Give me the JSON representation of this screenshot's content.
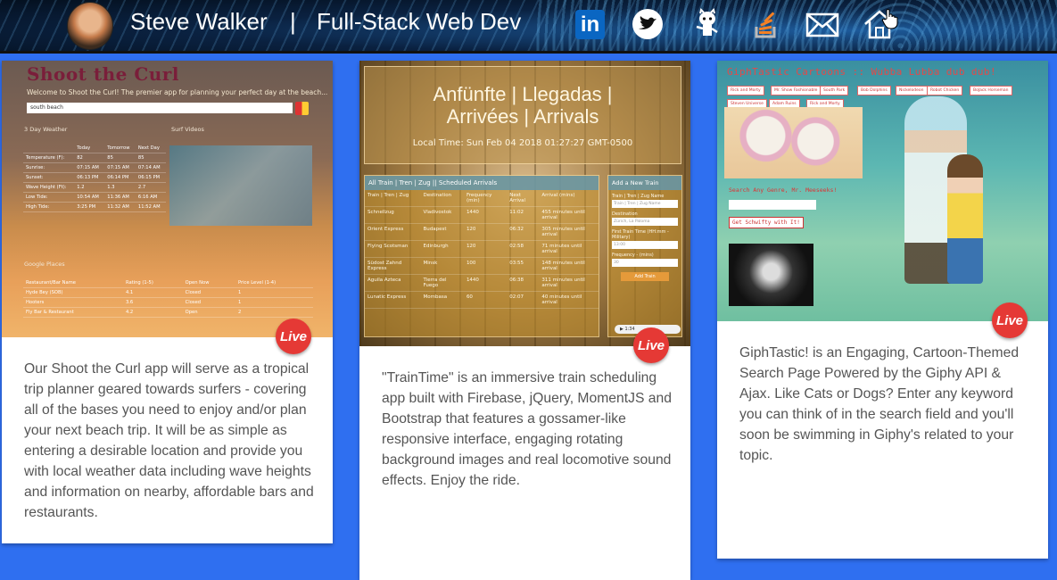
{
  "header": {
    "name": "Steve Walker",
    "separator": "|",
    "role": "Full-Stack Web Dev",
    "icons": [
      "linkedin-icon",
      "twitter-icon",
      "github-icon",
      "stackoverflow-icon",
      "mail-icon",
      "home-icon"
    ],
    "linkedin_glyph": "in"
  },
  "colors": {
    "page_bg": "#2f6ff0",
    "live_badge": "#e53935",
    "card_text": "#555555"
  },
  "cards": [
    {
      "live": "Live",
      "description": "Our Shoot the Curl app will serve as a tropical trip planner geared towards surfers - covering all of the bases you need to enjoy and/or plan your next beach trip. It will be as simple as entering a desirable location and provide you with local weather data including wave heights and information on nearby, affordable bars and restaurants.",
      "screenshot": {
        "title": "Shoot the Curl",
        "welcome": "Welcome to Shoot the Curl! The premier app for planning your perfect day at the beach...",
        "search_value": "south beach",
        "weather_label": "3 Day Weather",
        "videos_label": "Surf Videos",
        "places_label": "Google Places",
        "weather_header": [
          "",
          "Today",
          "Tomorrow",
          "Next Day"
        ],
        "weather_rows": [
          [
            "Temperature (F):",
            "82",
            "85",
            "85"
          ],
          [
            "Sunrise:",
            "07:15 AM",
            "07:15 AM",
            "07:14 AM"
          ],
          [
            "Sunset:",
            "06:13 PM",
            "06:14 PM",
            "06:15 PM"
          ],
          [
            "Wave Height (Ft):",
            "1.2",
            "1.3",
            "2.7"
          ],
          [
            "Low Tide:",
            "10:54 AM",
            "11:36 AM",
            "6:16 AM"
          ],
          [
            "High Tide:",
            "3:25 PM",
            "11:32 AM",
            "11:52 AM"
          ]
        ],
        "places_header": [
          "Restaurant/Bar Name",
          "Rating (1-5)",
          "Open Now",
          "Price Level (1-4)"
        ],
        "places_rows": [
          [
            "Hyde Bey (SOB)",
            "4.1",
            "Closed",
            "1"
          ],
          [
            "Hooters",
            "3.6",
            "Closed",
            "1"
          ],
          [
            "Fly Bar & Restaurant",
            "4.2",
            "Open",
            "2"
          ]
        ]
      }
    },
    {
      "live": "Live",
      "description": "\"TrainTime\" is an immersive train scheduling app built with Firebase, jQuery, MomentJS and Bootstrap that features a gossamer-like responsive interface, engaging rotating background images and real locomotive sound effects. Enjoy the ride.",
      "screenshot": {
        "heading_line1": "Anfünfte | Llegadas |",
        "heading_line2": "Arrivées | Arrivals",
        "local_time": "Local Time: Sun Feb 04 2018 01:27:27 GMT-0500",
        "table_title": "All Train | Tren | Zug || Scheduled Arrivals",
        "table_header": [
          "Train | Tren | Zug",
          "Destination",
          "Frequency (min)",
          "Next Arrival",
          "Arrival (mins)"
        ],
        "table_rows": [
          [
            "Schnellzug",
            "Vladivostok",
            "1440",
            "11:02",
            "455 minutes until arrival"
          ],
          [
            "Orient Express",
            "Budapest",
            "120",
            "06:32",
            "305 minutes until arrival"
          ],
          [
            "Flying Scotsman",
            "Edinburgh",
            "120",
            "02:58",
            "71 minutes until arrival"
          ],
          [
            "Südost Zahnd Express",
            "Minsk",
            "100",
            "03:55",
            "148 minutes until arrival"
          ],
          [
            "Aguila Azteca",
            "Tierra del Fuego",
            "1440",
            "06:38",
            "311 minutes until arrival"
          ],
          [
            "Lunatic Express",
            "Mombasa",
            "60",
            "02:07",
            "40 minutes until arrival"
          ]
        ],
        "form_title": "Add a New Train",
        "form_fields": [
          {
            "label": "Train | Tren | Zug Name",
            "placeholder": "Train | Tren | Zug Name"
          },
          {
            "label": "Destination",
            "placeholder": "Zürich, La Paloma"
          },
          {
            "label": "First Train Time (HH:mm - Military)",
            "placeholder": "13:00"
          },
          {
            "label": "Frequency - (mins)",
            "placeholder": "30"
          }
        ],
        "form_button": "Add Train",
        "player_time": "1:34"
      }
    },
    {
      "live": "Live",
      "description": "GiphTastic! is an Engaging, Cartoon-Themed Search Page Powered by the Giphy API & Ajax. Like Cats or Dogs? Enter any keyword you can think of in the search field and you'll soon be swimming in Giphy's related to your topic.",
      "screenshot": {
        "title": "GiphTastic Cartoons :: Wubba Lubba dub dub!",
        "tags": [
          "Rick and Morty",
          "Mr. Show Fashionable",
          "South Park",
          "Bob Dolphins",
          "Nickelodeon",
          "Robot Chicken",
          "BoJack Horseman",
          "Steven Universe",
          "Adam Ruins",
          "Rick and Morty"
        ],
        "search_label": "Search Any Genre, Mr. Meeseeks!",
        "search_button": "Get Schwifty with It!"
      }
    }
  ]
}
